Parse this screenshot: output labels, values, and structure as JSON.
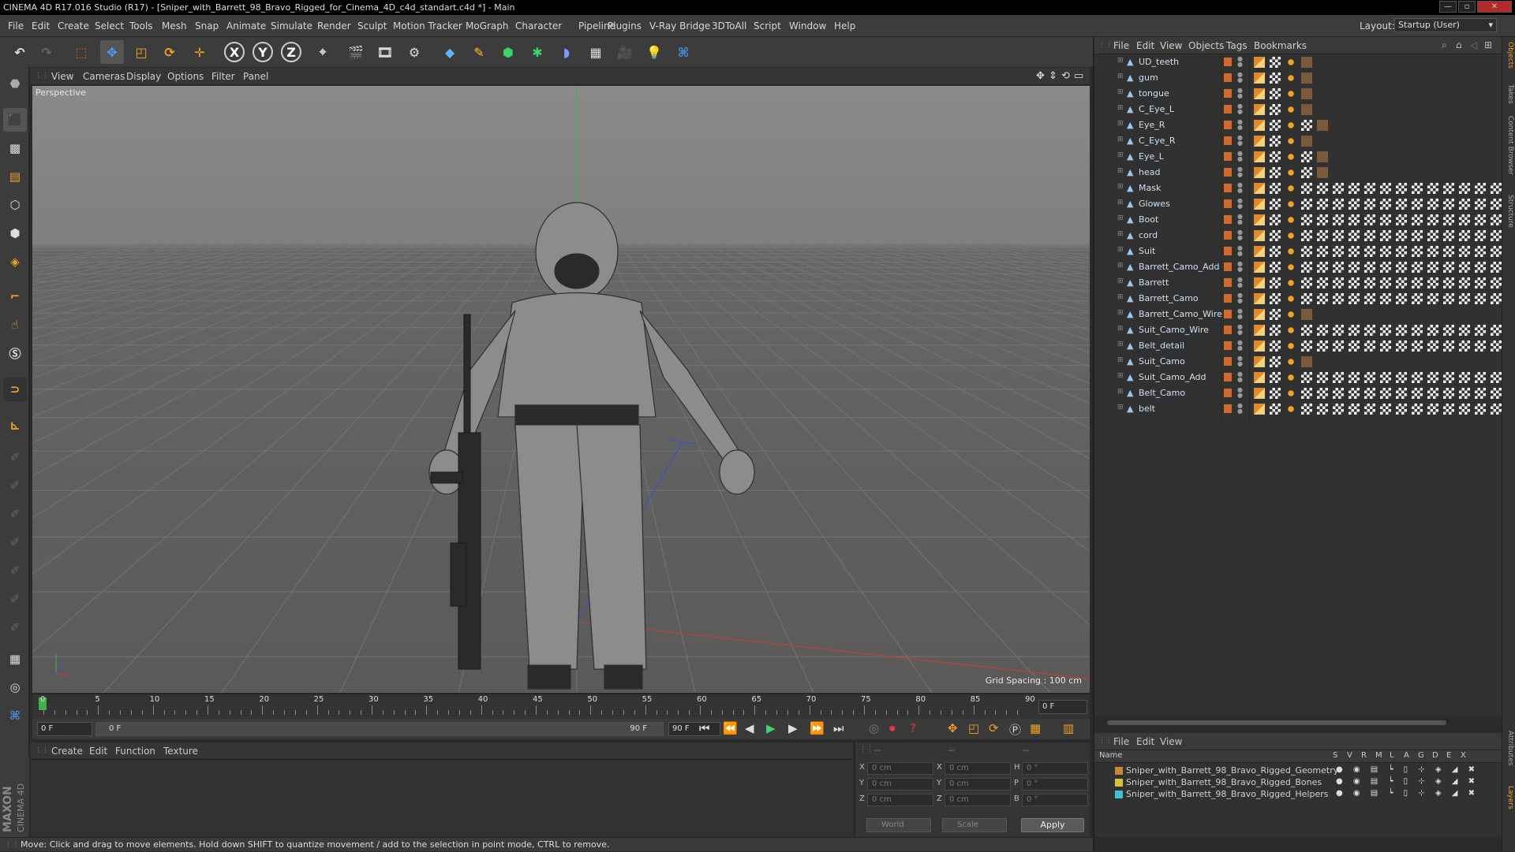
{
  "window": {
    "title": "CINEMA 4D R17.016 Studio (R17) - [Sniper_with_Barrett_98_Bravo_Rigged_for_Cinema_4D_c4d_standart.c4d *] - Main",
    "minimize_label": "—",
    "maximize_label": "▫",
    "close_label": "✕"
  },
  "menu": {
    "items": [
      "File",
      "Edit",
      "Create",
      "Select",
      "Tools",
      "Mesh",
      "Snap",
      "Animate",
      "Simulate",
      "Render",
      "Sculpt",
      "Motion Tracker",
      "MoGraph",
      "Character",
      "Pipeline",
      "Plugins",
      "V-Ray Bridge",
      "3DToAll",
      "Script",
      "Window",
      "Help"
    ],
    "layout_label": "Layout:",
    "layout_value": "Startup (User)"
  },
  "toolbar": {
    "axis_x": "X",
    "axis_y": "Y",
    "axis_z": "Z"
  },
  "viewport": {
    "menu": [
      "View",
      "Cameras",
      "Display",
      "Options",
      "Filter",
      "Panel"
    ],
    "label": "Perspective",
    "grid_spacing": "Grid Spacing : 100 cm",
    "colors": {
      "sky": "#8a8a8a",
      "floor": "#5a5a5a",
      "x_axis": "#cc3b3b",
      "y_axis": "#3bb34a",
      "z_axis": "#3b4ecc"
    }
  },
  "timeline": {
    "ticks": [
      "0",
      "5",
      "10",
      "15",
      "20",
      "25",
      "30",
      "35",
      "40",
      "45",
      "50",
      "55",
      "60",
      "65",
      "70",
      "75",
      "80",
      "85",
      "90"
    ],
    "current_frame_display": "0 F",
    "start_field": "0 F",
    "range_start": "0 F",
    "range_end": "90 F",
    "end_field": "90 F"
  },
  "material_manager": {
    "menu": [
      "Create",
      "Edit",
      "Function",
      "Texture"
    ],
    "logo_line1": "MAXON",
    "logo_line2": "CINEMA 4D"
  },
  "coordinates": {
    "header_dashes": [
      "--",
      "--",
      "--"
    ],
    "rows": [
      {
        "a_label": "X",
        "a_val": "0 cm",
        "b_label": "X",
        "b_val": "0 cm",
        "c_label": "H",
        "c_val": "0 °"
      },
      {
        "a_label": "Y",
        "a_val": "0 cm",
        "b_label": "Y",
        "b_val": "0 cm",
        "c_label": "P",
        "c_val": "0 °"
      },
      {
        "a_label": "Z",
        "a_val": "0 cm",
        "b_label": "Z",
        "b_val": "0 cm",
        "c_label": "B",
        "c_val": "0 °"
      }
    ],
    "space_select": "World",
    "mode_select": "Scale",
    "apply_label": "Apply"
  },
  "status": {
    "text": "Move: Click and drag to move elements. Hold down SHIFT to quantize movement / add to the selection in point mode, CTRL to remove."
  },
  "object_manager": {
    "menu": [
      "File",
      "Edit",
      "View",
      "Objects",
      "Tags",
      "Bookmarks"
    ],
    "objects": [
      {
        "name": "UD_teeth",
        "tags": 4
      },
      {
        "name": "gum",
        "tags": 4
      },
      {
        "name": "tongue",
        "tags": 4
      },
      {
        "name": "C_Eye_L",
        "tags": 4
      },
      {
        "name": "Eye_R",
        "tags": 5
      },
      {
        "name": "C_Eye_R",
        "tags": 4
      },
      {
        "name": "Eye_L",
        "tags": 5
      },
      {
        "name": "head",
        "tags": 5
      },
      {
        "name": "Mask",
        "tags": 16
      },
      {
        "name": "Glowes",
        "tags": 16
      },
      {
        "name": "Boot",
        "tags": 16
      },
      {
        "name": "cord",
        "tags": 16
      },
      {
        "name": "Suit",
        "tags": 16
      },
      {
        "name": "Barrett_Camo_Add",
        "tags": 16
      },
      {
        "name": "Barrett",
        "tags": 16
      },
      {
        "name": "Barrett_Camo",
        "tags": 16
      },
      {
        "name": "Barrett_Camo_Wire",
        "tags": 4
      },
      {
        "name": "Suit_Camo_Wire",
        "tags": 16
      },
      {
        "name": "Belt_detail",
        "tags": 16
      },
      {
        "name": "Suit_Camo",
        "tags": 4
      },
      {
        "name": "Suit_Camo_Add",
        "tags": 16
      },
      {
        "name": "Belt_Camo",
        "tags": 16
      },
      {
        "name": "belt",
        "tags": 16
      }
    ]
  },
  "layer_manager": {
    "menu": [
      "File",
      "Edit",
      "View"
    ],
    "header_name": "Name",
    "header_cols": [
      "S",
      "V",
      "R",
      "M",
      "L",
      "A",
      "G",
      "D",
      "E",
      "X"
    ],
    "layers": [
      {
        "name": "Sniper_with_Barrett_98_Bravo_Rigged_Geometry",
        "color": "#c8843a"
      },
      {
        "name": "Sniper_with_Barrett_98_Bravo_Rigged_Bones",
        "color": "#d4c43a"
      },
      {
        "name": "Sniper_with_Barrett_98_Bravo_Rigged_Helpers",
        "color": "#3ac4d4"
      }
    ]
  },
  "side_tabs": [
    "Objects",
    "Takes",
    "Content Browser",
    "Structure",
    "Attributes",
    "Layers"
  ]
}
